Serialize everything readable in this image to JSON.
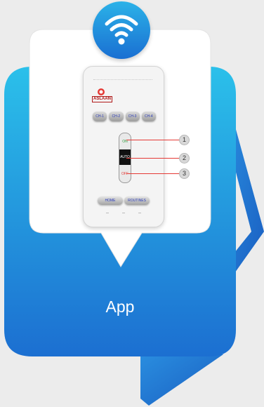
{
  "brand": {
    "name": "ASLAAN"
  },
  "channels": [
    "CH-1",
    "CH-2",
    "CH-3",
    "CH-4"
  ],
  "switch": {
    "on": "ON",
    "auto": "AUTO",
    "off": "OFF"
  },
  "callouts": [
    "1",
    "2",
    "3"
  ],
  "bottom_buttons": {
    "home": "HOME",
    "routines": "ROUTINES"
  },
  "card": {
    "label": "App"
  },
  "colors": {
    "card_gradient_top": "#2bbbe8",
    "card_gradient_bottom": "#1d6fd0",
    "accent_red": "#e53935",
    "on_green": "#2e9a3c"
  },
  "icons": {
    "wifi": "wifi-icon"
  }
}
